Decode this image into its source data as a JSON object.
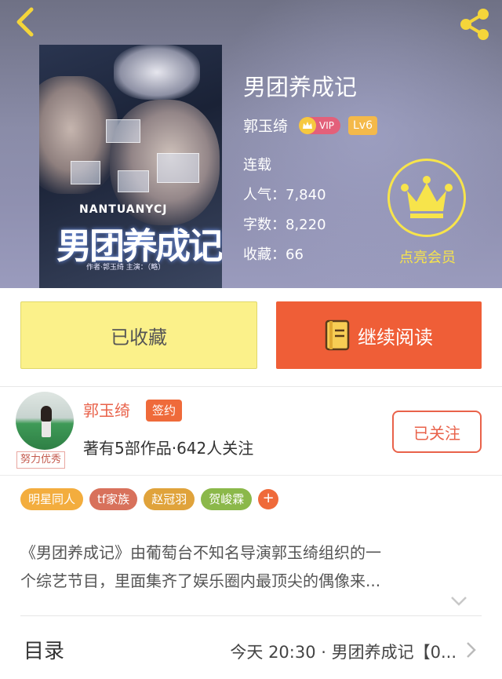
{
  "header": {
    "back_icon": "back-arrow-icon",
    "share_icon": "share-icon"
  },
  "cover": {
    "english_title": "NANTUANYCJ",
    "big_title": "男团养成记",
    "credit_line": "作者·郭玉绮  主演：（略）"
  },
  "book": {
    "title": "男团养成记",
    "author": "郭玉绮",
    "vip_label": "VIP",
    "level_label": "Lv6",
    "status": "连载",
    "popularity": "人气：7,840",
    "word_count": "字数：8,220",
    "favorites": "收藏：66"
  },
  "member": {
    "label": "点亮会员",
    "color": "#f7e44b"
  },
  "actions": {
    "favorite_label": "已收藏",
    "read_label": "继续阅读",
    "favorite_color": "#fbf18a",
    "read_color": "#ef5e37"
  },
  "author_card": {
    "name": "郭玉绮",
    "signed_label": "签约",
    "info": "著有5部作品·642人关注",
    "follow_label": "已关注",
    "effort_tag": "努力优秀"
  },
  "tags": [
    {
      "label": "明星同人",
      "color": "#f3ad3e"
    },
    {
      "label": "tf家族",
      "color": "#d8715b"
    },
    {
      "label": "赵冠羽",
      "color": "#e0a33b"
    },
    {
      "label": "贺峻霖",
      "color": "#8bb84a"
    }
  ],
  "tag_add_label": "+",
  "synopsis": {
    "line1": "《男团养成记》由葡萄台不知名导演郭玉绮组织的一",
    "line2": "个综艺节目，里面集齐了娱乐圈内最顶尖的偶像来..."
  },
  "toc": {
    "label": "目录",
    "latest": "今天 20:30 · 男团养成记【0..."
  }
}
